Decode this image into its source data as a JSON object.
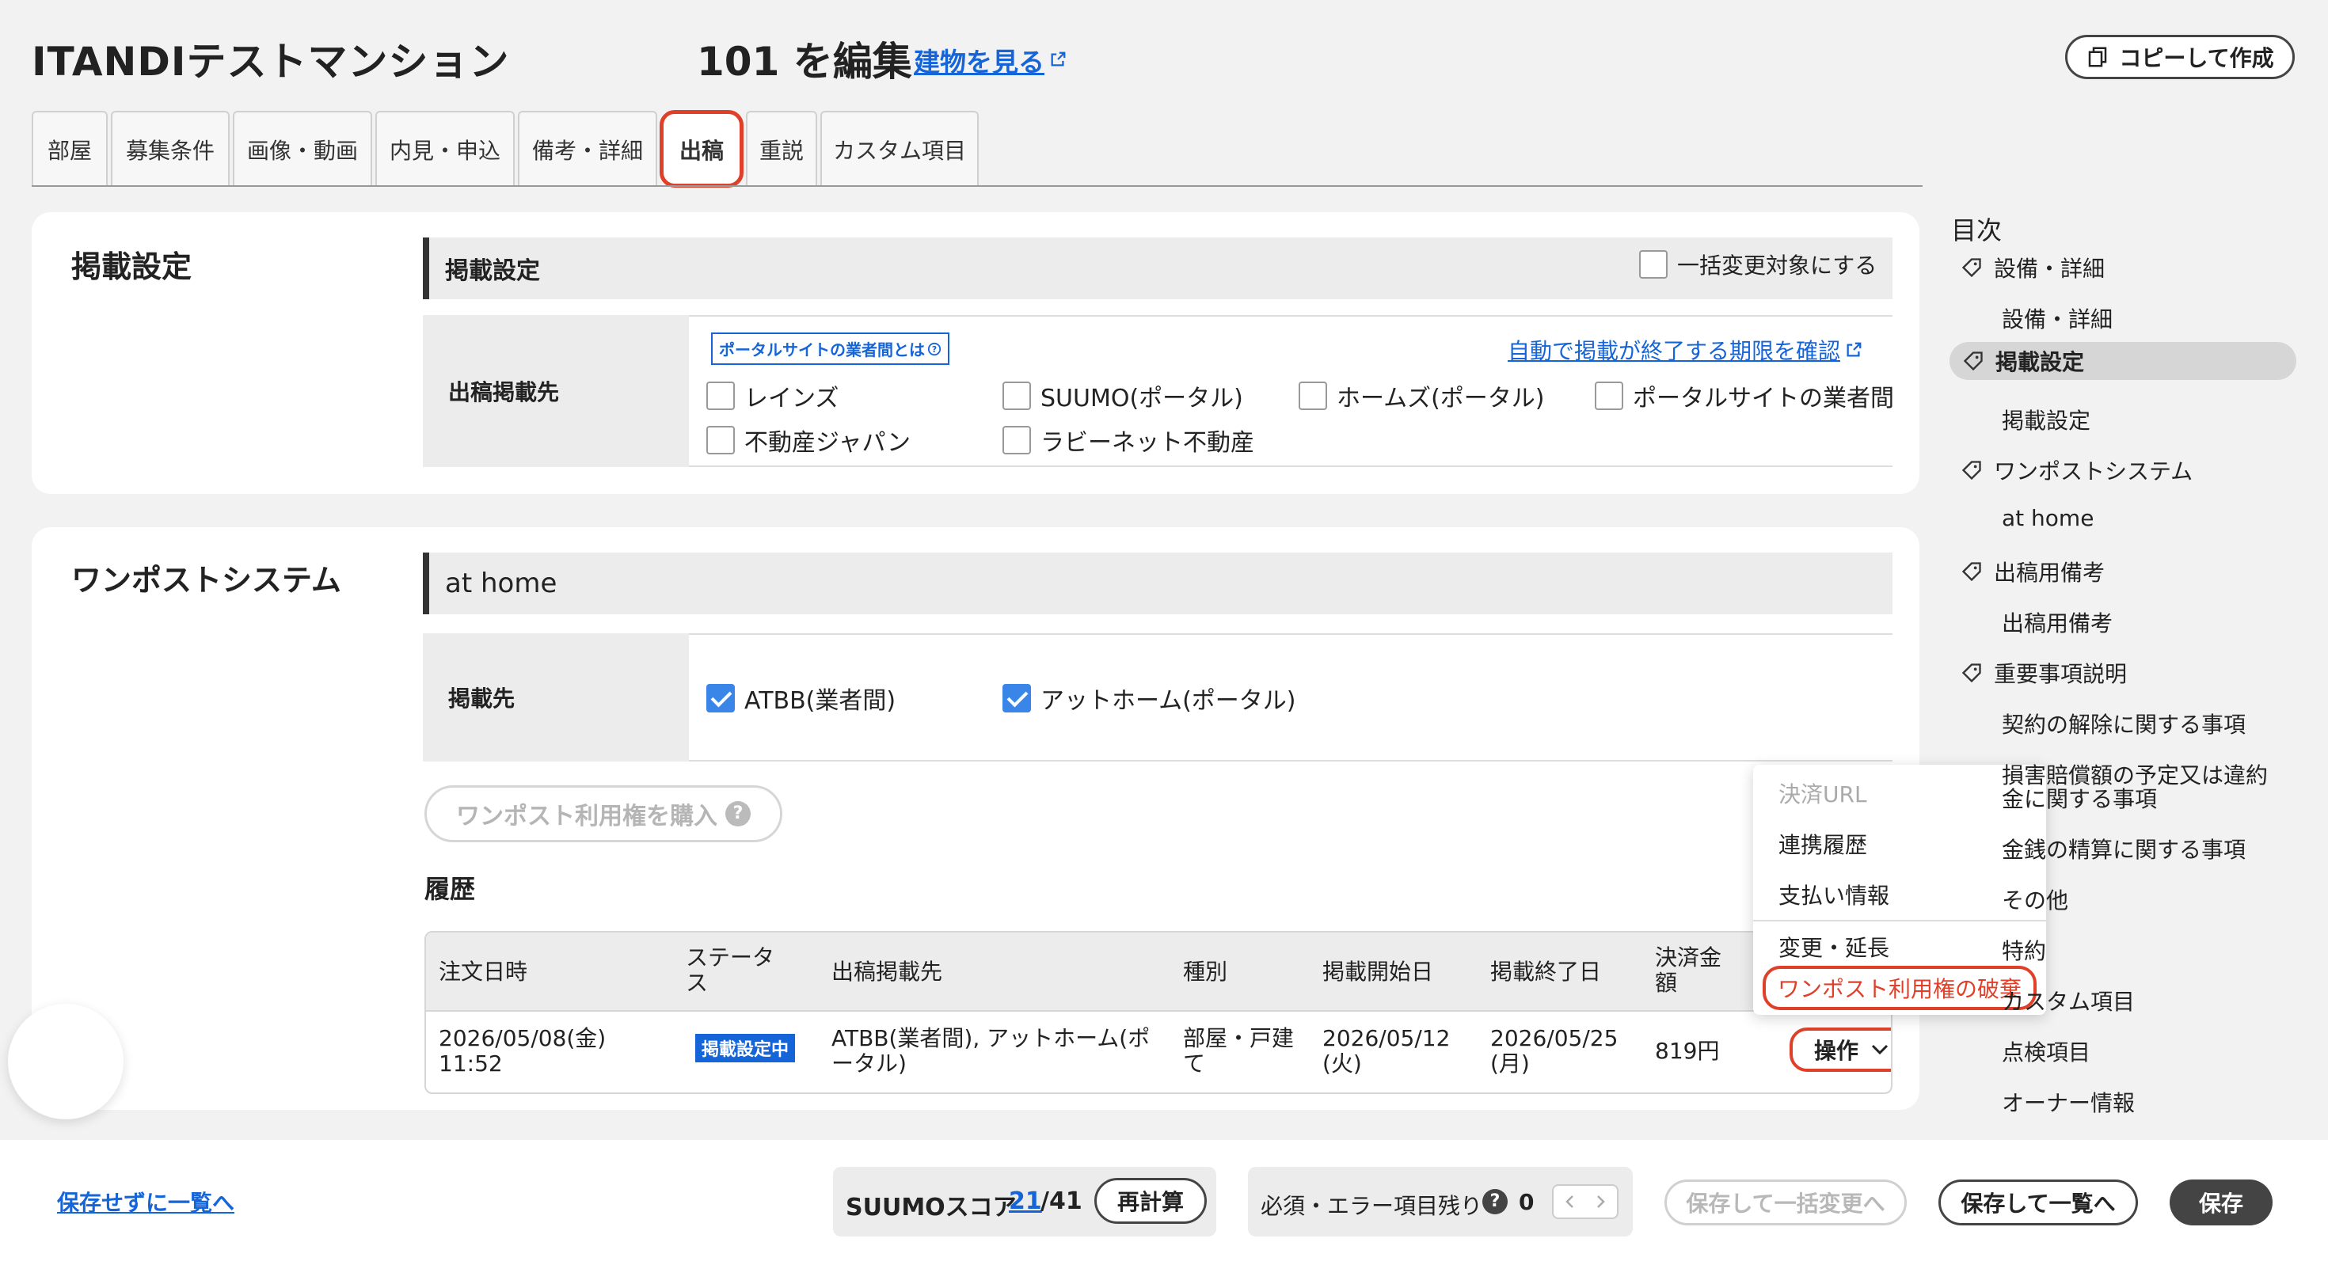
{
  "header": {
    "app_title": "ITANDIテストマンション",
    "room_title": "101 を編集",
    "view_building": "建物を見る",
    "copy_button": "コピーして作成"
  },
  "tabs": [
    {
      "label": "部屋"
    },
    {
      "label": "募集条件"
    },
    {
      "label": "画像・動画"
    },
    {
      "label": "内見・申込"
    },
    {
      "label": "備考・詳細"
    },
    {
      "label": "出稿",
      "active": true
    },
    {
      "label": "重説"
    },
    {
      "label": "カスタム項目"
    }
  ],
  "listing": {
    "card_title": "掲載設定",
    "section_title": "掲載設定",
    "bulk_change_label": "一括変更対象にする",
    "row_label": "出稿掲載先",
    "portal_badge": "ポータルサイトの業者間とは",
    "auto_end_link": "自動で掲載が終了する期限を確認",
    "options": [
      "レインズ",
      "SUUMO(ポータル)",
      "ホームズ(ポータル)",
      "ポータルサイトの業者間",
      "不動産ジャパン",
      "ラビーネット不動産"
    ]
  },
  "onepost": {
    "card_title": "ワンポストシステム",
    "section_title": "at home",
    "row_label": "掲載先",
    "options": [
      {
        "label": "ATBB(業者間)",
        "checked": true
      },
      {
        "label": "アットホーム(ポータル)",
        "checked": true
      }
    ],
    "purchase_button": "ワンポスト利用権を購入",
    "history_title": "履歴",
    "history_headers": [
      "注文日時",
      "ステータス",
      "出稿掲載先",
      "種別",
      "掲載開始日",
      "掲載終了日",
      "決済金額"
    ],
    "history_header_lines": {
      "status": [
        "ステータ",
        "ス"
      ],
      "amount": [
        "決済金",
        "額"
      ]
    },
    "history_row": {
      "date": [
        "2026/05/08(金)",
        "11:52"
      ],
      "status": "掲載設定中",
      "destinations": [
        "ATBB(業者間), アットホーム(ポ",
        "ータル)"
      ],
      "type": [
        "部屋・戸建",
        "て"
      ],
      "start": [
        "2026/05/12",
        "(火)"
      ],
      "end": [
        "2026/05/25",
        "(月)"
      ],
      "amount": "819円",
      "ops_button": "操作"
    }
  },
  "ops_menu": {
    "items": [
      "決済URL",
      "連携履歴",
      "支払い情報",
      "変更・延長",
      "ワンポスト利用権の破棄"
    ]
  },
  "toc": {
    "title": "目次",
    "items": [
      {
        "label": "設備・詳細",
        "level": 1
      },
      {
        "label": "設備・詳細",
        "level": 2
      },
      {
        "label": "掲載設定",
        "level": 1,
        "active": true
      },
      {
        "label": "掲載設定",
        "level": 2
      },
      {
        "label": "ワンポストシステム",
        "level": 1
      },
      {
        "label": "at home",
        "level": 2
      },
      {
        "label": "出稿用備考",
        "level": 1
      },
      {
        "label": "出稿用備考",
        "level": 2
      },
      {
        "label": "重要事項説明",
        "level": 1
      },
      {
        "label": "契約の解除に関する事項",
        "level": 2
      },
      {
        "label": "損害賠償額の予定又は違約",
        "level": 2
      },
      {
        "label": "金に関する事項",
        "level": 2
      },
      {
        "label": "金銭の精算に関する事項",
        "level": 2
      },
      {
        "label": "その他",
        "level": 2
      },
      {
        "label": "特約",
        "level": 2
      },
      {
        "label": "カスタム項目",
        "level": 2
      },
      {
        "label": "点検項目",
        "level": 2
      },
      {
        "label": "オーナー情報",
        "level": 2
      }
    ]
  },
  "footer": {
    "back_link": "保存せずに一覧へ",
    "score_label": "SUUMOスコア",
    "score_value": "21",
    "score_total": "/41",
    "recalc_button": "再計算",
    "remaining_label": "必須・エラー項目残り",
    "remaining_count": "0",
    "bulk_save_button": "保存して一括変更へ",
    "save_list_button": "保存して一覧へ",
    "save_button": "保存"
  },
  "colors": {
    "accent_blue": "#1565d8",
    "highlight_red": "#e0402a",
    "checkbox_blue": "#3a86e8"
  }
}
